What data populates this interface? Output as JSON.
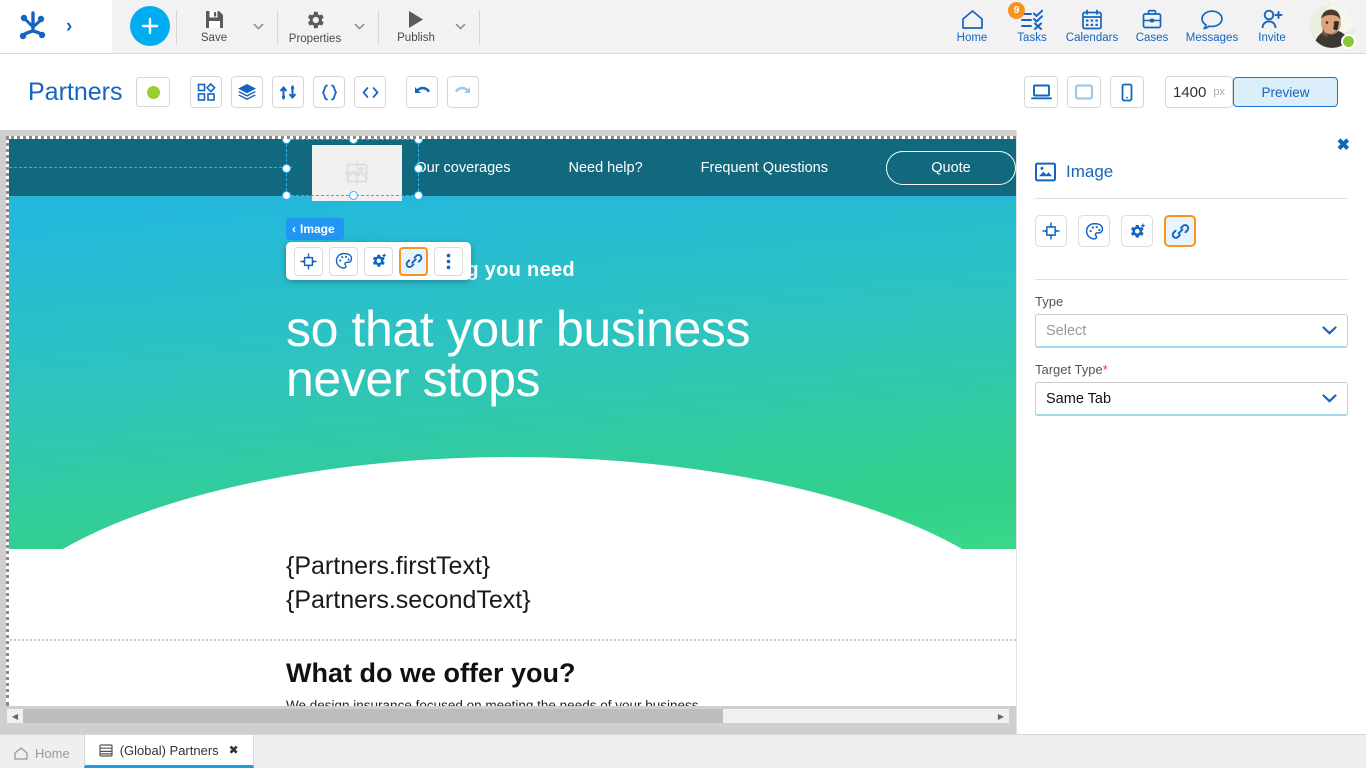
{
  "topbar": {
    "logo_icon": "anchor-logo-icon",
    "expand_arrow_icon": "chevron-right-icon",
    "add_button_label": "+",
    "items": [
      {
        "label": "Save",
        "icon": "floppy-save-icon",
        "has_caret": true
      },
      {
        "label": "Properties",
        "icon": "gear-icon",
        "has_caret": true
      },
      {
        "label": "Publish",
        "icon": "play-triangle-icon",
        "has_caret": true
      }
    ],
    "right_items": [
      {
        "label": "Home",
        "icon": "home-icon",
        "badge": ""
      },
      {
        "label": "Tasks",
        "icon": "tasklist-icon",
        "badge": "9"
      },
      {
        "label": "Calendars",
        "icon": "calendar-icon",
        "badge": ""
      },
      {
        "label": "Cases",
        "icon": "briefcase-icon",
        "badge": ""
      },
      {
        "label": "Messages",
        "icon": "chat-bubble-icon",
        "badge": ""
      },
      {
        "label": "Invite",
        "icon": "person-add-icon",
        "badge": ""
      }
    ],
    "avatar_name": "user-avatar",
    "avatar_status": "online"
  },
  "secondbar": {
    "page_title": "Partners",
    "status_dot_color": "#9acd32",
    "tool_icons": [
      "components-grid-icon",
      "layers-icon",
      "flow-icon",
      "braces-icon",
      "code-icon"
    ],
    "undo_icon": "undo-arrow-icon",
    "redo_icon": "redo-arrow-icon",
    "devices": [
      {
        "name": "desktop",
        "icon": "desktop-icon",
        "selected": true
      },
      {
        "name": "tablet",
        "icon": "tablet-icon",
        "selected": false
      },
      {
        "name": "mobile",
        "icon": "mobile-icon",
        "selected": false
      }
    ],
    "width_value": "1400",
    "width_unit": "px",
    "preview_label": "Preview"
  },
  "canvas": {
    "site": {
      "nav_links": [
        "Our coverages",
        "Need help?",
        "Frequent Questions"
      ],
      "nav_cta": "Quote",
      "hero_subtitle": "We have everything you need",
      "hero_title_line1": "so that your business",
      "hero_title_line2": "never stops",
      "template_line1": "{Partners.firstText}",
      "template_line2": "{Partners.secondText}",
      "offer_title": "What do we offer you?",
      "offer_subtitle": "We design insurance focused on meeting the needs of your business"
    },
    "selection": {
      "element_tag": "Image",
      "back_chevron": "‹",
      "placeholder_icon": "image-placeholder-icon",
      "toolbar_buttons": [
        {
          "name": "move-resize",
          "icon": "move-arrows-icon",
          "active": false
        },
        {
          "name": "style",
          "icon": "palette-icon",
          "active": false
        },
        {
          "name": "settings",
          "icon": "gear-sparkle-icon",
          "active": false
        },
        {
          "name": "link",
          "icon": "link-chain-icon",
          "active": true
        },
        {
          "name": "more",
          "icon": "kebab-dots-icon",
          "active": false
        }
      ]
    },
    "scrollbar": {
      "left_arrow": "◀",
      "right_arrow": "▶"
    }
  },
  "right_panel": {
    "close_icon": "close-x-icon",
    "title": "Image",
    "title_icon": "image-icon",
    "tabs": [
      {
        "name": "move-resize",
        "icon": "move-arrows-icon",
        "active": false
      },
      {
        "name": "style",
        "icon": "palette-icon",
        "active": false
      },
      {
        "name": "settings",
        "icon": "gear-sparkle-icon",
        "active": false
      },
      {
        "name": "link",
        "icon": "link-chain-icon",
        "active": true
      }
    ],
    "fields": [
      {
        "label": "Type",
        "required": false,
        "value": "",
        "placeholder": "Select"
      },
      {
        "label": "Target Type",
        "required": true,
        "value": "Same Tab",
        "placeholder": ""
      }
    ],
    "required_marker": "*",
    "chevron_icon": "chevron-down-icon"
  },
  "bottom_tabs": [
    {
      "label": "Home",
      "icon": "home-outline-icon",
      "active": false,
      "closable": false
    },
    {
      "label": "(Global) Partners",
      "icon": "page-icon",
      "active": true,
      "closable": true,
      "close_glyph": "✖"
    }
  ]
}
